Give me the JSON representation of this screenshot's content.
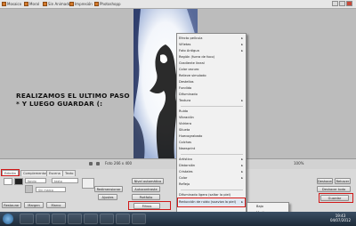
{
  "tabs": [
    {
      "label": "Mosaico",
      "icon": "mosaic-icon"
    },
    {
      "label": "Moral",
      "icon": "image-icon"
    },
    {
      "label": "Sin Animado",
      "icon": "image-icon"
    },
    {
      "label": "Impresión",
      "icon": "print-icon"
    },
    {
      "label": "Photoshopp",
      "icon": "image-icon"
    }
  ],
  "canvas": {
    "headline_line1": "REALIZAMOS EL ULTIMO PASO",
    "headline_line2": "* Y LUEGO GUARDAR (:"
  },
  "status": {
    "size_text": "Foto 266 x 400",
    "zoom_text": "100%"
  },
  "panel": {
    "tabs": [
      "Edición",
      "Complementos",
      "Escena",
      "Texto"
    ],
    "tab_active": "Edición",
    "field_fondo": "fondo",
    "field_marco": "Sin marco",
    "field_texto": "texto",
    "btn_redimensionar": "Redimensionar",
    "btn_autocontraste": "Autocontraste",
    "btn_nivel": "Nivel automático",
    "btn_ajustes": "Ajustes",
    "btn_portfolio": "Portfolio",
    "btn_filtros": "Filtros",
    "btn_nivel_a": "Nivel a.",
    "btn_rotar_izq": "Rotar",
    "btn_rotar_der": "Rotar",
    "btn_deshacer": "Deshacer",
    "btn_rehacer": "Rehacer",
    "btn_deshacer_todo": "Deshacer todo",
    "btn_guardar": "Guardar",
    "btn_bottom1": "Restaurar",
    "btn_bottom2": "Margen",
    "btn_bottom3": "Marco"
  },
  "menu": {
    "items": [
      {
        "label": "Efecto película",
        "arrow": true
      },
      {
        "label": "Viñetas",
        "arrow": true
      },
      {
        "label": "Foto Antigua",
        "arrow": true
      },
      {
        "label": "Región (fuera de foco)",
        "arrow": false
      },
      {
        "label": "Gradiente lineal",
        "arrow": false
      },
      {
        "label": "Color oscuro",
        "arrow": false
      },
      {
        "label": "Relieve simulado",
        "arrow": false
      },
      {
        "label": "Destellos",
        "arrow": false
      },
      {
        "label": "Fundido",
        "arrow": false
      },
      {
        "label": "Difuminado",
        "arrow": false
      },
      {
        "label": "Textura",
        "arrow": true
      },
      {
        "label": "Ruido",
        "arrow": false
      },
      {
        "label": "Vibración",
        "arrow": false
      },
      {
        "label": "Vidriera",
        "arrow": false
      },
      {
        "label": "Silueta",
        "arrow": false
      },
      {
        "label": "Huecograbado",
        "arrow": false
      },
      {
        "label": "Colchas",
        "arrow": false
      },
      {
        "label": "Newsprint",
        "arrow": false
      },
      {
        "label": "Artístico",
        "arrow": true
      },
      {
        "label": "Distorsión",
        "arrow": true
      },
      {
        "label": "Cristales",
        "arrow": true
      },
      {
        "label": "Color",
        "arrow": true
      },
      {
        "label": "Reflejo",
        "arrow": false
      },
      {
        "label": "Difuminado ligero (saltar la piel)",
        "arrow": false
      },
      {
        "label": "Reducción de ruido (suaviza la piel)",
        "arrow": true
      }
    ],
    "submenu": [
      "Bajo",
      "Medio",
      "Alto"
    ]
  },
  "taskbar": {
    "time": "19:43",
    "date": "04/07/2012"
  }
}
